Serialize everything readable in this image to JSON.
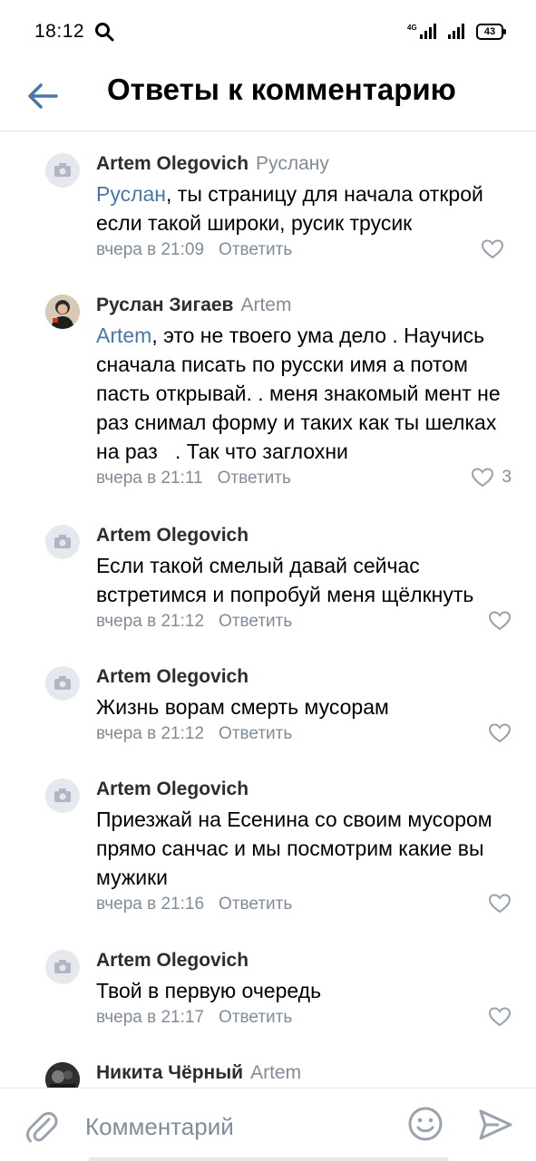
{
  "status_bar": {
    "time": "18:12",
    "network": "4G",
    "battery": "43"
  },
  "header": {
    "title": "Ответы к комментарию"
  },
  "comments": [
    {
      "author": "Artem Olegovich",
      "reply_to": "Руслану",
      "mention": "Руслан",
      "text": ", ты страницу для начала открой если такой широки, русик трусик",
      "time": "вчера в 21:09",
      "reply_label": "Ответить",
      "likes": ""
    },
    {
      "author": "Руслан Зигаев",
      "reply_to": "Artem",
      "mention": "Artem",
      "text": ", это не твоего ума дело . Научись сначала писать по русски имя а потом пасть открывай. . меня знакомый мент не раз снимал форму и таких как ты шелках на раз   . Так что заглохни",
      "time": "вчера в 21:11",
      "reply_label": "Ответить",
      "likes": "3"
    },
    {
      "author": "Artem Olegovich",
      "reply_to": "",
      "mention": "",
      "text": "Если такой смелый давай сейчас встретимся и попробуй меня щёлкнуть",
      "time": "вчера в 21:12",
      "reply_label": "Ответить",
      "likes": ""
    },
    {
      "author": "Artem Olegovich",
      "reply_to": "",
      "mention": "",
      "text": "Жизнь ворам смерть мусорам",
      "time": "вчера в 21:12",
      "reply_label": "Ответить",
      "likes": ""
    },
    {
      "author": "Artem Olegovich",
      "reply_to": "",
      "mention": "",
      "text": "Приезжай на Есенина со своим мусором прямо санчас и мы посмотрим какие вы мужики",
      "time": "вчера в 21:16",
      "reply_label": "Ответить",
      "likes": ""
    },
    {
      "author": "Artem Olegovich",
      "reply_to": "",
      "mention": "",
      "text": "Твой в первую очередь",
      "time": "вчера в 21:17",
      "reply_label": "Ответить",
      "likes": ""
    },
    {
      "author": "Никита Чёрный",
      "reply_to": "Artem",
      "mention": "",
      "text": "",
      "time": "",
      "reply_label": "",
      "likes": ""
    }
  ],
  "composer": {
    "placeholder": "Комментарий"
  },
  "colors": {
    "accent": "#4a76a8",
    "muted": "#818c99",
    "avatar_placeholder": "#e5e8ec"
  },
  "icons": [
    "search-icon",
    "back-arrow-icon",
    "camera-icon",
    "heart-icon",
    "attach-icon",
    "emoji-icon",
    "send-icon"
  ]
}
